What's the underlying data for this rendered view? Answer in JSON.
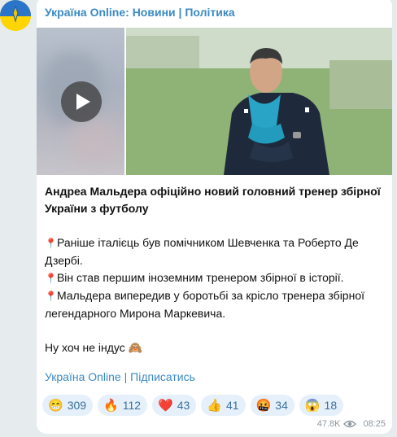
{
  "channel": {
    "name": "Україна Online: Новини | Політика"
  },
  "post": {
    "headline": "Андреа Мальдера офіційно новий головний тренер збірної України з футболу",
    "bullets": [
      "Раніше італієць був помічником Шевченка та Роберто Де Дзербі.",
      "Він став першим іноземним тренером збірної в історії.",
      "Мальдера випередив у боротьбі за крісло тренера збірної легендарного Мирона Маркевича."
    ],
    "closing": "Ну хоч не індус 🙈",
    "subscribe_link": "Україна Online | Підписатись"
  },
  "reactions": [
    {
      "emoji": "😁",
      "count": "309"
    },
    {
      "emoji": "🔥",
      "count": "112"
    },
    {
      "emoji": "❤️",
      "count": "43"
    },
    {
      "emoji": "👍",
      "count": "41"
    },
    {
      "emoji": "🤬",
      "count": "34"
    },
    {
      "emoji": "😱",
      "count": "18"
    }
  ],
  "meta": {
    "views": "47.8K",
    "time": "08:25",
    "view_icon": "eye-icon"
  },
  "colors": {
    "accent": "#3a8ac3",
    "reaction_bg": "#e5f0fa",
    "background": "#e6ebee"
  }
}
